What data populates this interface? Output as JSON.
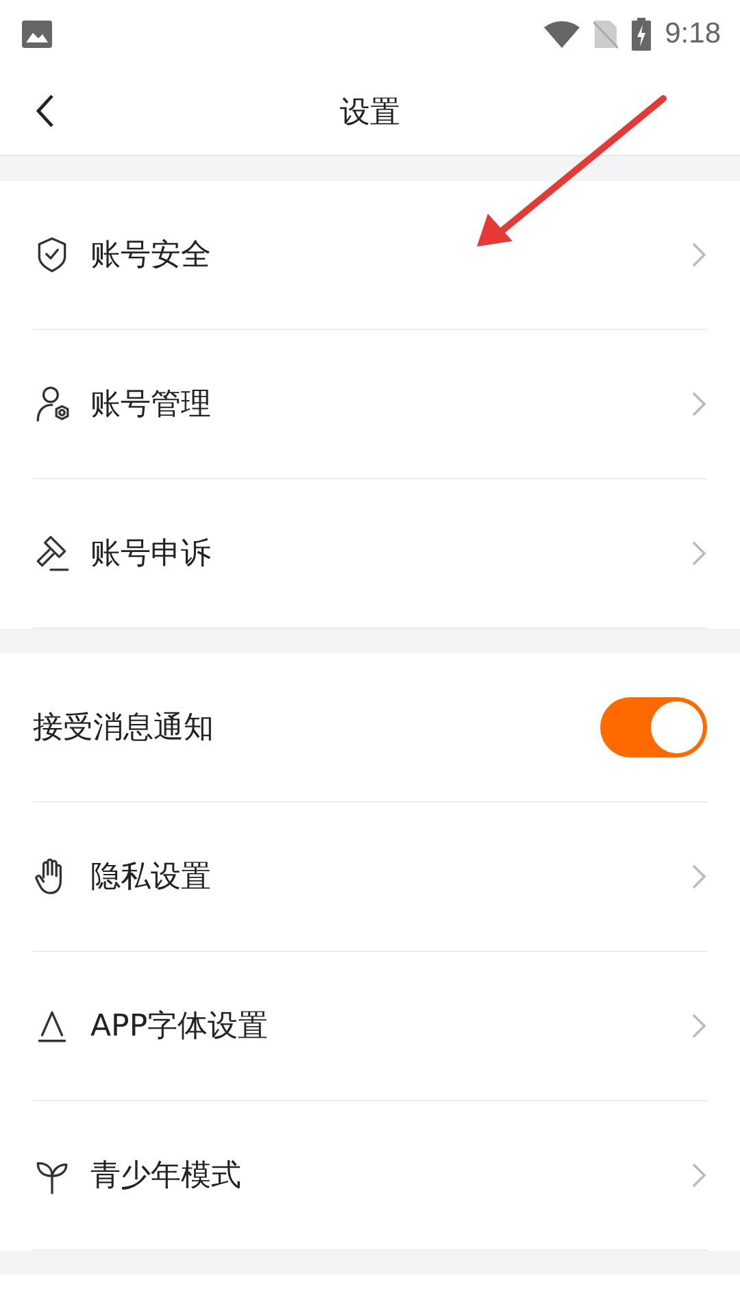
{
  "status_bar": {
    "time": "9:18"
  },
  "header": {
    "title": "设置"
  },
  "sections": [
    {
      "rows": [
        {
          "kind": "link",
          "label": "账号安全"
        },
        {
          "kind": "link",
          "label": "账号管理"
        },
        {
          "kind": "link",
          "label": "账号申诉"
        }
      ]
    },
    {
      "rows": [
        {
          "kind": "toggle",
          "label": "接受消息通知",
          "on": true
        },
        {
          "kind": "link",
          "label": "隐私设置"
        },
        {
          "kind": "link",
          "label": "APP字体设置"
        },
        {
          "kind": "link",
          "label": "青少年模式"
        }
      ]
    }
  ]
}
